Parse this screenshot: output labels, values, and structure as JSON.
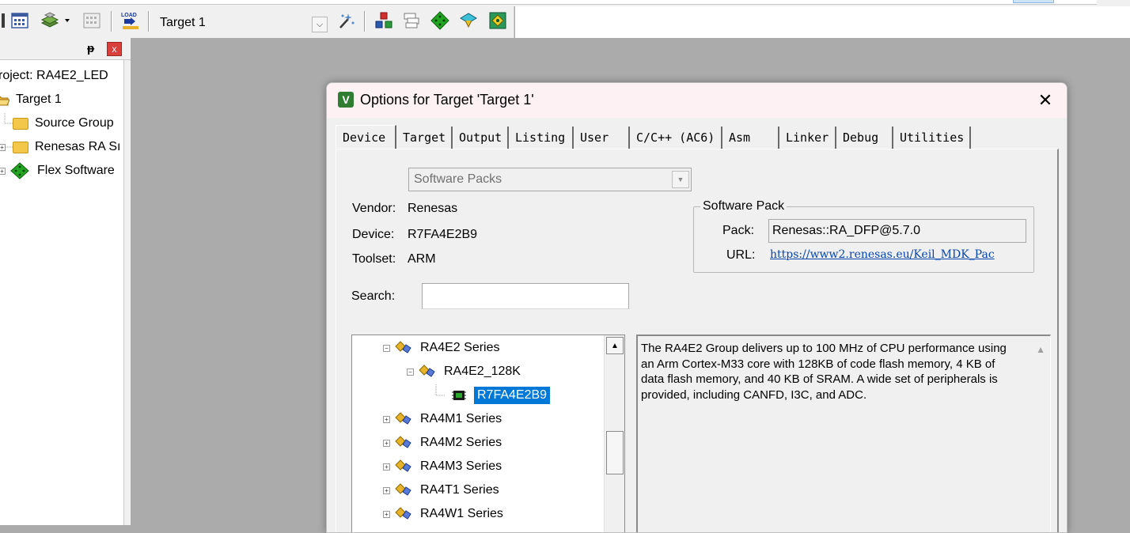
{
  "toolbar": {
    "target_select": "Target 1",
    "icons": [
      "batch-setup-icon",
      "stack-icon",
      "dropdown-arrow-icon",
      "grid-icon",
      "load-icon",
      "combo-arrow-icon",
      "magic-wand-icon",
      "manage-project-icon",
      "layers-icon",
      "green-diamond-icon",
      "teal-diamond-icon",
      "pack-installer-icon"
    ],
    "load_label": "LOAD"
  },
  "project_panel": {
    "pin": "ᵽ",
    "close": "x",
    "tree": [
      {
        "label": "roject: RA4E2_LED"
      },
      {
        "label": "Target 1"
      },
      {
        "label": "Source Group"
      },
      {
        "label": "Renesas RA Sı"
      },
      {
        "label": "Flex Software"
      }
    ]
  },
  "dialog": {
    "title": "Options for Target 'Target 1'",
    "close": "✕",
    "tabs": [
      "Device",
      "Target",
      "Output",
      "Listing",
      "User",
      "C/C++ (AC6)",
      "Asm",
      "Linker",
      "Debug",
      "Utilities"
    ],
    "active_tab": "Device",
    "software_packs_select": "Software Packs",
    "vendor_label": "Vendor:",
    "vendor_value": "Renesas",
    "device_label": "Device:",
    "device_value": "R7FA4E2B9",
    "toolset_label": "Toolset:",
    "toolset_value": "ARM",
    "search_label": "Search:",
    "search_value": "",
    "software_pack": {
      "legend": "Software Pack",
      "pack_label": "Pack:",
      "pack_value": "Renesas::RA_DFP@5.7.0",
      "url_label": "URL:",
      "url_value": "https://www2.renesas.eu/Keil_MDK_Pac"
    },
    "device_tree": [
      {
        "label": "RA4E2 Series",
        "expander": "−"
      },
      {
        "label": "RA4E2_128K",
        "expander": "−"
      },
      {
        "label": "R7FA4E2B9",
        "selected": true
      },
      {
        "label": "RA4M1 Series",
        "expander": "+"
      },
      {
        "label": "RA4M2 Series",
        "expander": "+"
      },
      {
        "label": "RA4M3 Series",
        "expander": "+"
      },
      {
        "label": "RA4T1 Series",
        "expander": "+"
      },
      {
        "label": "RA4W1 Series",
        "expander": "+"
      }
    ],
    "description": "The RA4E2 Group delivers up to 100 MHz of CPU performance using an Arm Cortex-M33 core with 128KB of code flash memory, 4 KB of data flash memory, and 40 KB of SRAM. A wide set of peripherals is provided, including CANFD, I3C, and ADC."
  },
  "colors": {
    "selection": "#0078d7",
    "link": "#0645ad",
    "close_red": "#d9403b"
  }
}
